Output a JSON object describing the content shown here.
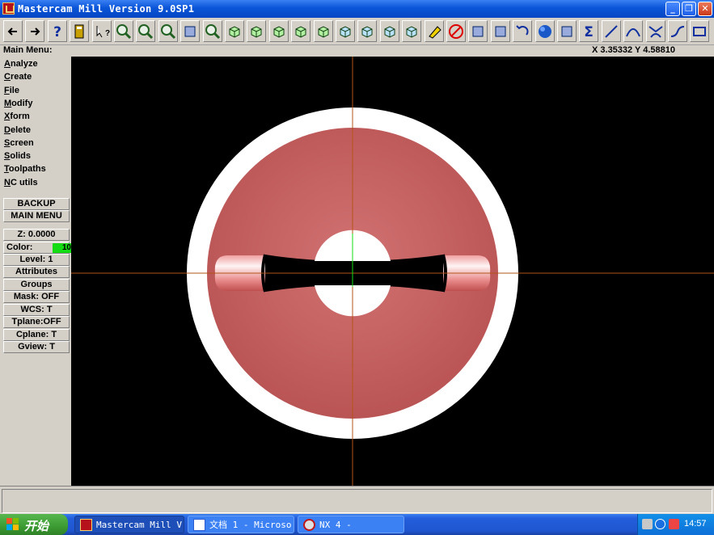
{
  "window": {
    "title": "Mastercam Mill Version 9.0SP1",
    "controls": [
      "minimize-icon",
      "restore-icon",
      "close-icon"
    ]
  },
  "toolbar": {
    "icons": [
      "arrow-left-icon",
      "arrow-right-icon",
      "help-icon",
      "calculator-icon",
      "pointer-help-icon",
      "zoom-window-icon",
      "zoom-fit-icon",
      "zoom-previous-icon",
      "pan-icon",
      "zoom-select-icon",
      "view-rotate-icon",
      "view-top-icon",
      "view-front-icon",
      "view-side-icon",
      "view-iso-icon",
      "cplane-top-icon",
      "cplane-front-icon",
      "cplane-side-icon",
      "cplane-3d-icon",
      "eraser-icon",
      "delete-icon",
      "copy-icon",
      "move-icon",
      "undo-icon",
      "sphere-icon",
      "transform-icon",
      "sum-icon",
      "line-icon",
      "arc-icon",
      "fillet-icon",
      "spline-icon",
      "rectangle-icon"
    ]
  },
  "status": {
    "menu_label": "Main Menu:",
    "coordinates": "X 3.35332  Y 4.58810"
  },
  "main_menu": {
    "items": [
      {
        "key": "A",
        "rest": "nalyze"
      },
      {
        "key": "C",
        "rest": "reate"
      },
      {
        "key": "F",
        "rest": "ile"
      },
      {
        "key": "M",
        "rest": "odify"
      },
      {
        "key": "X",
        "rest": "form"
      },
      {
        "key": "D",
        "rest": "elete"
      },
      {
        "key": "S",
        "rest": "creen"
      },
      {
        "key": "So",
        "rest": "lids",
        "underline_index": 1
      },
      {
        "key": "T",
        "rest": "oolpaths"
      },
      {
        "key": "N",
        "rest": "C utils"
      }
    ],
    "backup_label": "BACKUP",
    "main_menu_label": "MAIN MENU"
  },
  "settings": {
    "z": "Z:  0.0000",
    "color_label": "Color:",
    "color_value": "10",
    "level": "Level:  1",
    "attributes": "Attributes",
    "groups": "Groups",
    "mask": "Mask:  OFF",
    "wcs": "WCS:  T",
    "tplane": "Tplane:OFF",
    "cplane": "Cplane:  T",
    "gview": "Gview:  T"
  },
  "colors": {
    "color_swatch": "#14dc14",
    "part_fill": "#c25c5c",
    "axis": "#b4541a"
  },
  "taskbar": {
    "start_label": "开始",
    "tasks": [
      {
        "label": "Mastercam Mill V...",
        "icon": "mastercam-icon",
        "active": true
      },
      {
        "label": "文档 1 - Microso...",
        "icon": "word-icon",
        "active": false
      },
      {
        "label": "NX 4 -",
        "icon": "nx-icon",
        "active": false
      }
    ],
    "clock": "14:57"
  }
}
